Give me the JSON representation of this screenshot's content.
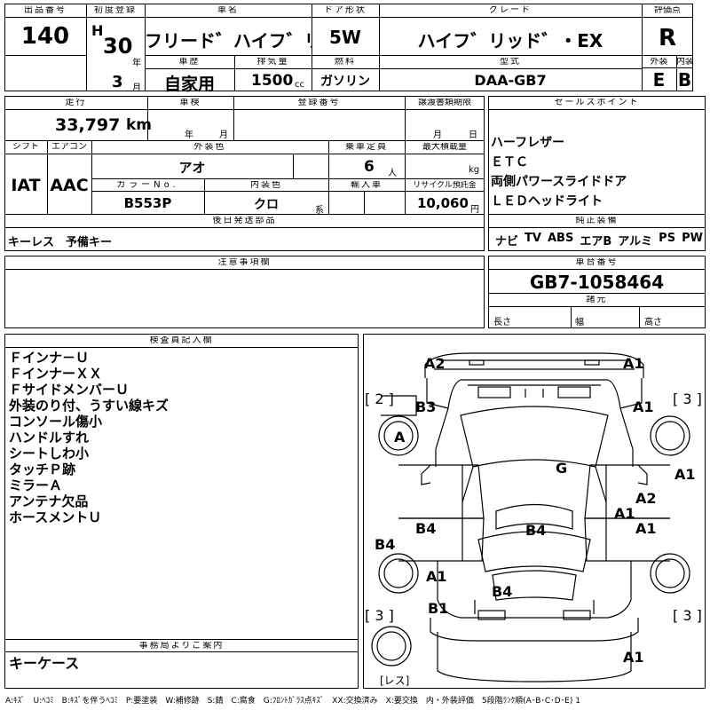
{
  "header": {
    "lot_no_label": "出品番号",
    "lot_no": "140",
    "first_reg_label": "初度登録",
    "era": "H",
    "year": "30",
    "year_unit": "年",
    "month": "3",
    "month_unit": "月",
    "car_name_label": "車名",
    "car_name": "フリード゛ハイフ゛リッド゛",
    "history_label": "車歴",
    "history": "自家用",
    "displacement_label": "排気量",
    "displacement": "1500",
    "displacement_unit": "cc",
    "door_label": "ドア形状",
    "door": "5W",
    "fuel_label": "燃料",
    "fuel": "ガソリン",
    "grade_label": "グレード",
    "grade": "ハイフ゛リッド゛・EX",
    "model_label": "型式",
    "model": "DAA-GB7",
    "score_label": "評価点",
    "score": "R",
    "exterior_label": "外装",
    "exterior": "E",
    "interior_label": "内装",
    "interior": "B"
  },
  "specs": {
    "mileage_label": "走行",
    "mileage": "33,797",
    "mileage_unit": "km",
    "inspection_label": "車検",
    "year_unit": "年",
    "month_unit": "月",
    "reg_no_label": "登録番号",
    "transfer_label": "譲渡書類期限",
    "shift_label": "シフト",
    "shift": "IAT",
    "ac_label": "エアコン",
    "ac": "AAC",
    "color_label": "外装色",
    "color": "アオ",
    "capacity_label": "乗車定員",
    "capacity": "6",
    "capacity_unit": "人",
    "max_load_label": "最大積載量",
    "max_load_unit": "kg",
    "color_no_label": "カラーNo.",
    "color_no": "B553P",
    "interior_color_label": "内装色",
    "interior_color": "クロ",
    "interior_color_suffix": "系",
    "import_label": "輸入車",
    "recycle_label": "リサイクル預託金",
    "recycle": "10,060",
    "recycle_unit": "円",
    "later_parts_label": "後日発送部品",
    "later_parts": "キーレス　予備キー"
  },
  "sales_points": {
    "label": "セールスポイント",
    "items": [
      "ハーフレザー",
      "ＥＴＣ",
      "両側パワースライドドア",
      "ＬＥＤヘッドライト"
    ]
  },
  "equipment": {
    "label": "純正装備",
    "items": [
      "ナビ",
      "TV",
      "ABS",
      "エアB",
      "アルミ",
      "PS",
      "PW"
    ]
  },
  "caution": {
    "label": "注意事項欄"
  },
  "chassis": {
    "label": "車台番号",
    "value": "GB7-1058464",
    "dims_label": "諸元",
    "length_label": "長さ",
    "width_label": "幅",
    "height_label": "高さ"
  },
  "inspector": {
    "label": "検査員記入欄",
    "notes": [
      "Ｆインナ－Ｕ",
      "ＦインナーＸＸ",
      "ＦサイドメンバーＵ",
      "外装のり付、うすい線キズ",
      "コンソール傷小",
      "ハンドルすれ",
      "シートしわ小",
      "タッチＰ跡",
      "ミラーＡ",
      "アンテナ欠品",
      "ホースメントＵ"
    ]
  },
  "office": {
    "label": "事務局よりご案内",
    "value": "キーケース"
  },
  "diagram": {
    "labels": [
      "A2",
      "A1",
      "[ 2 ]",
      "[ 3 ]",
      "B3",
      "A1",
      "A",
      "G",
      "A1",
      "A2",
      "A1",
      "B4",
      "B4",
      "A1",
      "B4",
      "A1",
      "B4",
      "B1",
      "[ 3 ]",
      "[ 3 ]",
      "A1",
      "[レス]"
    ]
  },
  "legend": "A:ｷｽﾞ　U:ﾍｺﾐ　B:ｷｽﾞを伴うﾍｺﾐ　P:要塗装　W:補修跡　S:錆　C:腐食　G:ﾌﾛﾝﾄｶﾞﾗｽ点ｷｽﾞ　XX:交換済み　X:要交換　内・外装評価　5段階ﾗﾝｸ順(A･B･C･D･E) 1"
}
